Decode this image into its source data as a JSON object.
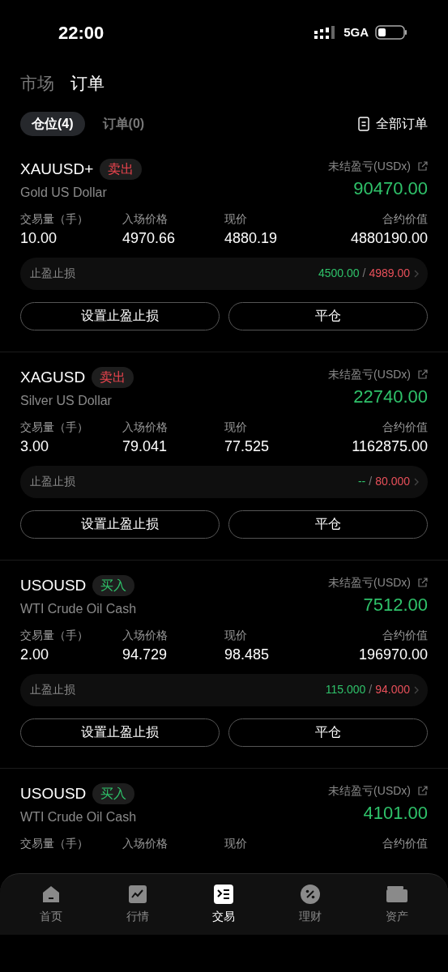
{
  "status_bar": {
    "time": "22:00",
    "network": "5GA"
  },
  "header_tabs": [
    {
      "label": "市场",
      "selected": false
    },
    {
      "label": "订单",
      "selected": true
    }
  ],
  "sub_tabs": [
    {
      "label": "仓位(4)",
      "selected": true
    },
    {
      "label": "订单(0)",
      "selected": false
    }
  ],
  "all_orders_link": "全部订单",
  "positions": [
    {
      "symbol": "XAUUSD+",
      "side": "卖出",
      "kind": "sell",
      "name": "Gold US Dollar",
      "pnl_label": "未结盈亏(USDx)",
      "pnl": "90470.00",
      "stats": [
        {
          "label": "交易量（手）",
          "value": "10.00"
        },
        {
          "label": "入场价格",
          "value": "4970.66"
        },
        {
          "label": "现价",
          "value": "4880.19"
        },
        {
          "label": "合约价值",
          "value": "4880190.00"
        }
      ],
      "tpsl_label": "止盈止损",
      "take_profit": "4500.00",
      "separator": "/",
      "stop_loss": "4989.00",
      "buttons": [
        "设置止盈止损",
        "平仓"
      ]
    },
    {
      "symbol": "XAGUSD",
      "side": "卖出",
      "kind": "sell",
      "name": "Silver US Dollar",
      "pnl_label": "未结盈亏(USDx)",
      "pnl": "22740.00",
      "stats": [
        {
          "label": "交易量（手）",
          "value": "3.00"
        },
        {
          "label": "入场价格",
          "value": "79.041"
        },
        {
          "label": "现价",
          "value": "77.525"
        },
        {
          "label": "合约价值",
          "value": "1162875.00"
        }
      ],
      "tpsl_label": "止盈止损",
      "take_profit": "--",
      "separator": "/",
      "stop_loss": "80.000",
      "buttons": [
        "设置止盈止损",
        "平仓"
      ]
    },
    {
      "symbol": "USOUSD",
      "side": "买入",
      "kind": "buy",
      "name": "WTI Crude Oil Cash",
      "pnl_label": "未结盈亏(USDx)",
      "pnl": "7512.00",
      "stats": [
        {
          "label": "交易量（手）",
          "value": "2.00"
        },
        {
          "label": "入场价格",
          "value": "94.729"
        },
        {
          "label": "现价",
          "value": "98.485"
        },
        {
          "label": "合约价值",
          "value": "196970.00"
        }
      ],
      "tpsl_label": "止盈止损",
      "take_profit": "115.000",
      "separator": "/",
      "stop_loss": "94.000",
      "buttons": [
        "设置止盈止损",
        "平仓"
      ]
    },
    {
      "symbol": "USOUSD",
      "side": "买入",
      "kind": "buy",
      "name": "WTI Crude Oil Cash",
      "pnl_label": "未结盈亏(USDx)",
      "pnl": "4101.00",
      "stats": [
        {
          "label": "交易量（手）"
        },
        {
          "label": "入场价格"
        },
        {
          "label": "现价"
        },
        {
          "label": "合约价值"
        }
      ]
    }
  ],
  "bottom_nav": [
    {
      "label": "首页",
      "selected": false
    },
    {
      "label": "行情",
      "selected": false
    },
    {
      "label": "交易",
      "selected": true
    },
    {
      "label": "理财",
      "selected": false
    },
    {
      "label": "资产",
      "selected": false
    }
  ]
}
